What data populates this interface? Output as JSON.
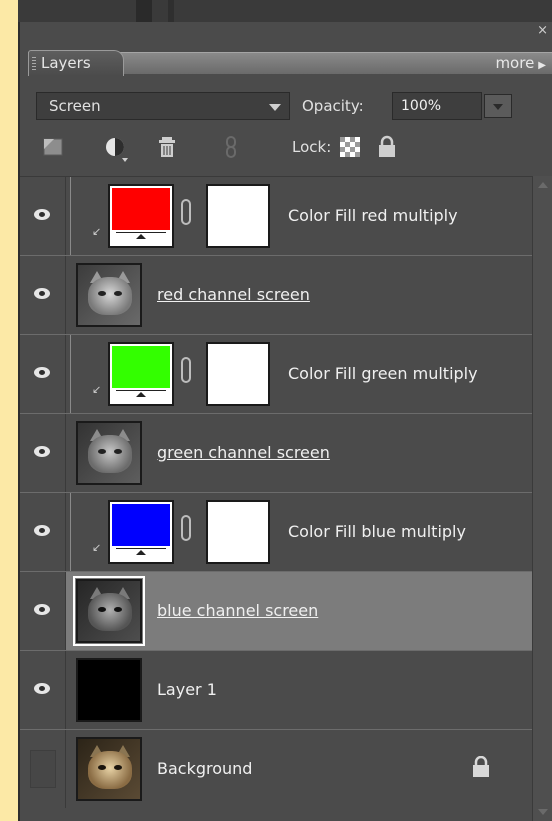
{
  "panel": {
    "tab_label": "Layers",
    "more_label": "more",
    "close_glyph": "×"
  },
  "controls": {
    "blend_mode": "Screen",
    "opacity_label": "Opacity:",
    "opacity_value": "100%",
    "lock_label": "Lock:"
  },
  "colors": {
    "red_fill": "#ff0000",
    "green_fill": "#33ff00",
    "blue_fill": "#0000ff",
    "selected_row": "#7c7c7c"
  },
  "layers": [
    {
      "name": "Color Fill red multiply",
      "kind": "fill",
      "color": "#ff0000",
      "visible": true
    },
    {
      "name": "red channel screen",
      "kind": "image",
      "visible": true
    },
    {
      "name": "Color Fill green multiply",
      "kind": "fill",
      "color": "#33ff00",
      "visible": true
    },
    {
      "name": "green channel screen",
      "kind": "image",
      "visible": true
    },
    {
      "name": "Color Fill blue multiply",
      "kind": "fill",
      "color": "#0000ff",
      "visible": true
    },
    {
      "name": "blue channel screen",
      "kind": "image",
      "visible": true,
      "selected": true
    },
    {
      "name": "Layer 1",
      "kind": "black",
      "visible": true
    },
    {
      "name": "Background",
      "kind": "background",
      "visible": false,
      "locked": true
    }
  ],
  "icons": {
    "new_layer": "new-layer-icon",
    "adjustment": "adjustment-layer-icon",
    "delete": "trash-icon",
    "link": "link-icon",
    "lock_transparent": "lock-transparent-icon",
    "lock_all": "lock-icon",
    "visibility": "eye-icon"
  }
}
